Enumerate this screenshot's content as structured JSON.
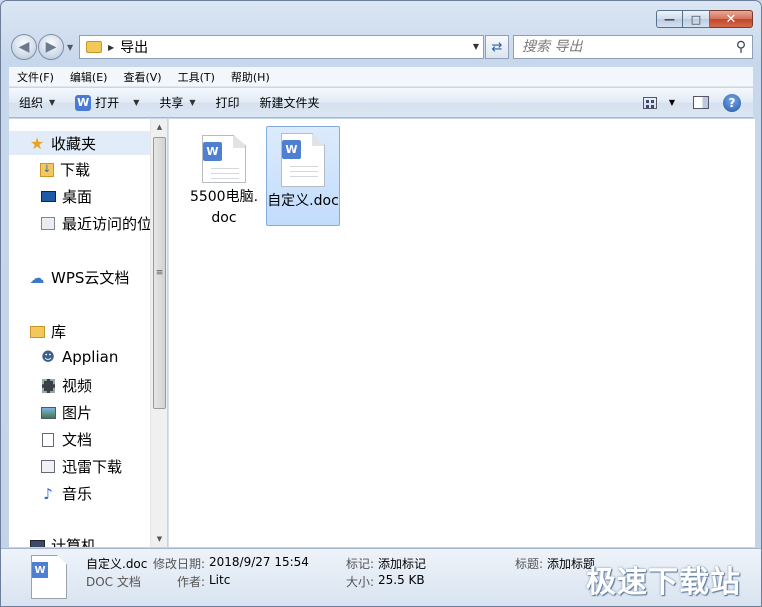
{
  "window": {
    "controls": {
      "minimize": "—",
      "maximize": "□",
      "close": "✕"
    }
  },
  "address": {
    "path": "导出"
  },
  "search": {
    "placeholder": "搜索 导出"
  },
  "menu": [
    "文件(F)",
    "编辑(E)",
    "查看(V)",
    "工具(T)",
    "帮助(H)"
  ],
  "toolbar": {
    "organize": "组织",
    "open": "打开",
    "share": "共享",
    "print": "打印",
    "new_folder": "新建文件夹",
    "help": "?"
  },
  "nav": {
    "favorites": "收藏夹",
    "downloads": "下载",
    "desktop": "桌面",
    "recent": "最近访问的位置",
    "wps_cloud": "WPS云文档",
    "libraries": "库",
    "applian": "Applian",
    "videos": "视频",
    "pictures": "图片",
    "documents": "文档",
    "xunlei": "迅雷下载",
    "music": "音乐",
    "computer": "计算机"
  },
  "files": [
    {
      "name": "5500电脑.doc",
      "selected": false
    },
    {
      "name": "自定义.doc",
      "selected": true
    }
  ],
  "details": {
    "filename": "自定义.doc",
    "filetype": "DOC 文档",
    "modified_label": "修改日期:",
    "modified_value": "2018/9/27 15:54",
    "author_label": "作者:",
    "author_value": "Litc",
    "tags_label": "标记:",
    "tags_value": "添加标记",
    "size_label": "大小:",
    "size_value": "25.5 KB",
    "title_label": "标题:",
    "title_value": "添加标题"
  },
  "watermark": "极速下载站",
  "colors": {
    "accent": "#4f7fd1",
    "selection": "#c1dcfc",
    "folder": "#f3c75c"
  }
}
